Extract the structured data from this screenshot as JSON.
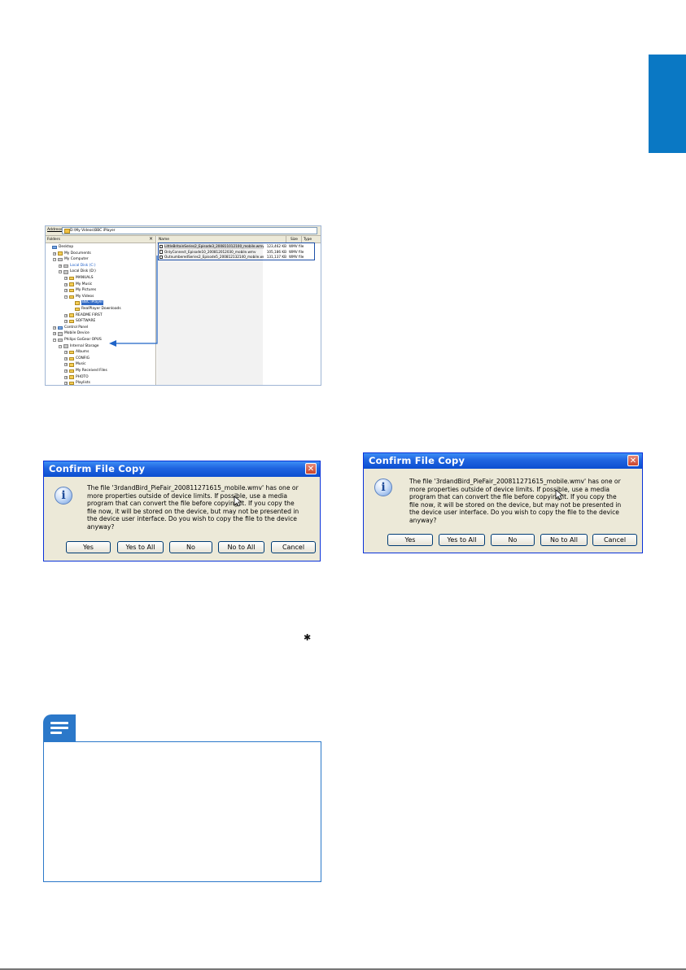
{
  "explorer": {
    "address_label": "Address",
    "address_path": "D:\\My Videos\\BBC iPlayer",
    "folders_label": "Folders",
    "close_glyph": "×",
    "tree": [
      {
        "label": "Desktop",
        "exp": "",
        "kind": "blue"
      },
      {
        "label": "My Documents",
        "exp": "+",
        "kind": "folder"
      },
      {
        "label": "My Computer",
        "exp": "−",
        "kind": "gray"
      },
      {
        "label": "Local Disk (C:)",
        "exp": "+",
        "kind": "gray",
        "text": "blue"
      },
      {
        "label": "Local Disk (D:)",
        "exp": "−",
        "kind": "gray"
      },
      {
        "label": "MANUALS",
        "exp": "+",
        "kind": "folder"
      },
      {
        "label": "My Music",
        "exp": "+",
        "kind": "folder"
      },
      {
        "label": "My Pictures",
        "exp": "+",
        "kind": "folder"
      },
      {
        "label": "My Videos",
        "exp": "−",
        "kind": "folder"
      },
      {
        "label": "BBC iPlayer",
        "exp": "",
        "kind": "folder",
        "text": "sel"
      },
      {
        "label": "RealPlayer Downloads",
        "exp": "",
        "kind": "folder"
      },
      {
        "label": "README FIRST",
        "exp": "+",
        "kind": "folder"
      },
      {
        "label": "SOFTWARE",
        "exp": "+",
        "kind": "folder"
      },
      {
        "label": "Control Panel",
        "exp": "+",
        "kind": "blue"
      },
      {
        "label": "Mobile Device",
        "exp": "+",
        "kind": "gray"
      },
      {
        "label": "Philips GoGear OPUS",
        "exp": "−",
        "kind": "gray"
      },
      {
        "label": "Internal Storage",
        "exp": "−",
        "kind": "gray"
      },
      {
        "label": "Albums",
        "exp": "+",
        "kind": "folder"
      },
      {
        "label": "CONFIG",
        "exp": "+",
        "kind": "folder"
      },
      {
        "label": "Music",
        "exp": "+",
        "kind": "folder"
      },
      {
        "label": "My Received Files",
        "exp": "+",
        "kind": "folder"
      },
      {
        "label": "PHOTO",
        "exp": "+",
        "kind": "folder"
      },
      {
        "label": "Playlists",
        "exp": "+",
        "kind": "folder"
      }
    ],
    "columns": {
      "name": "Name",
      "size": "Size",
      "type": "Type"
    },
    "files": [
      {
        "name": "LittleBritainSeries2_Episode3_200811012100_mobile.wmv",
        "size": "123,462 KB",
        "type": "WMV file"
      },
      {
        "name": "OnlyConnect_Episode10_200812012030_mobile.wmv",
        "size": "105,186 KB",
        "type": "WMV file"
      },
      {
        "name": "OutnumberedSeries2_Episode5_200812132140_mobile.wmv",
        "size": "131,137 KB",
        "type": "WMV file"
      }
    ]
  },
  "dialog": {
    "title": "Confirm File Copy",
    "close": "✕",
    "icon": "i",
    "message": "The file '3rdandBird_PieFair_200811271615_mobile.wmv' has one or\nmore properties outside of device limits. If possible, use a media\nprogram that can convert the file before copying it. If you copy the\nfile now, it will be stored on the device, but may not be presented in\nthe device user interface. Do you wish to copy the file to the device\nanyway?",
    "buttons": {
      "yes": "Yes",
      "yes_all": "Yes to All",
      "no": "No",
      "no_all": "No to All",
      "cancel": "Cancel"
    }
  },
  "icons": {
    "gear": "✱",
    "accent": "#0a78c4",
    "note": "#2b78c9"
  }
}
